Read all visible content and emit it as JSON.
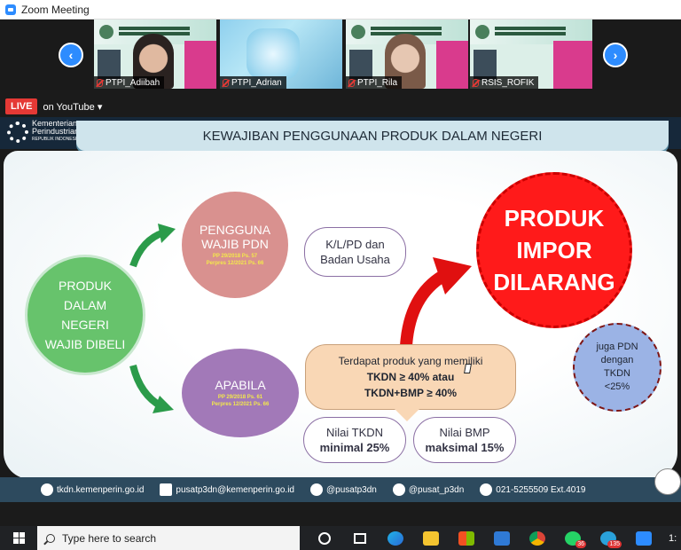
{
  "window": {
    "title": "Zoom Meeting"
  },
  "participants": [
    {
      "name": "PTPI_Adiibah"
    },
    {
      "name": "PTPI_Adrian"
    },
    {
      "name": "PTPI_Rila"
    },
    {
      "name": "RSIS_ROFIK"
    }
  ],
  "live": {
    "badge": "LIVE",
    "destination": "on YouTube"
  },
  "slide": {
    "logo_name_1": "Kementerian",
    "logo_name_2": "Perindustrian",
    "logo_sub": "REPUBLIK INDONESIA",
    "title": "KEWAJIBAN PENGGUNAAN PRODUK DALAM NEGERI",
    "produk": [
      "PRODUK",
      "DALAM",
      "NEGERI",
      "WAJIB DIBELI"
    ],
    "pengguna": {
      "line1": "PENGGUNA",
      "line2": "WAJIB PDN",
      "ref1": "PP 29/2018 Ps. 57",
      "ref2": "Perpres 12/2021 Ps. 66"
    },
    "kl": {
      "line1": "K/L/PD dan",
      "line2": "Badan Usaha"
    },
    "apabila": {
      "label": "APABILA",
      "ref1": "PP 29/2018 Ps. 61",
      "ref2": "Perpres 12/2021 Ps. 66"
    },
    "terdapat": {
      "line1": "Terdapat produk yang memiliki",
      "line2": "TKDN ≥ 40% atau",
      "line3": "TKDN+BMP ≥ 40%"
    },
    "tkdn_box": {
      "line1": "Nilai TKDN",
      "line2": "minimal 25%"
    },
    "bmp_box": {
      "line1": "Nilai BMP",
      "line2": "maksimal 15%"
    },
    "impor": [
      "PRODUK",
      "IMPOR",
      "DILARANG"
    ],
    "juga": [
      "juga PDN",
      "dengan",
      "TKDN",
      "<25%"
    ],
    "footer": {
      "site": "tkdn.kemenperin.go.id",
      "email": "pusatp3dn@kemenperin.go.id",
      "twitter": "@pusatp3dn",
      "instagram": "@pusat_p3dn",
      "phone": "021-5255509 Ext.4019"
    }
  },
  "taskbar": {
    "search_placeholder": "Type here to search",
    "clock": "1:",
    "badges": {
      "whatsapp": "36",
      "telegram": "135"
    }
  },
  "colors": {
    "zoom_blue": "#2d8cff",
    "live_red": "#e53935",
    "green": "#67c36c",
    "red": "#ff1a1a"
  }
}
